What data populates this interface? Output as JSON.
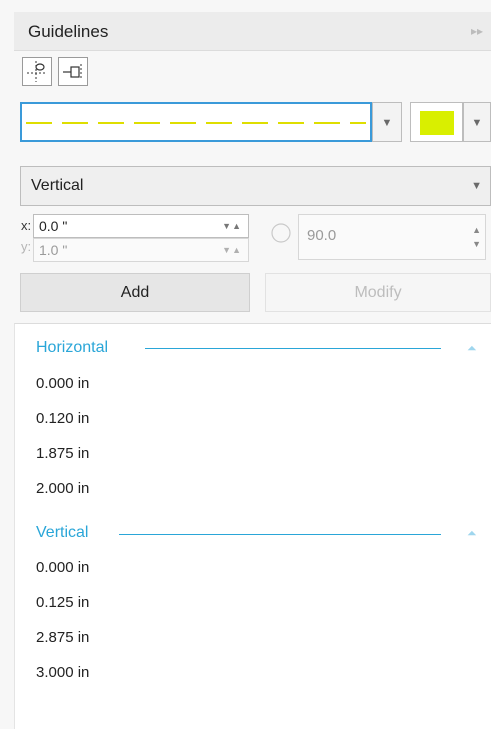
{
  "panel": {
    "title": "Guidelines",
    "collapse_icon": "double-chevron-right-icon"
  },
  "toolbar": {
    "tool1_icon": "guideline-point-icon",
    "tool2_icon": "guideline-object-icon"
  },
  "line_style": {
    "selected": "dashed",
    "color_name": "yellow",
    "color": "#dede00"
  },
  "color_picker": {
    "selected_color": "#d9ef00"
  },
  "orientation": {
    "selected": "Vertical"
  },
  "coords": {
    "x_label": "x:",
    "x_value": "0.0 \"",
    "y_label": "y:",
    "y_value": "1.0 \""
  },
  "angle": {
    "value": "90.0",
    "icon": "rotation-angle-icon"
  },
  "buttons": {
    "add": "Add",
    "modify": "Modify"
  },
  "guides": {
    "groups": [
      {
        "title": "Horizontal",
        "items": [
          "0.000 in",
          "0.120 in",
          "1.875 in",
          "2.000 in"
        ]
      },
      {
        "title": "Vertical",
        "items": [
          "0.000 in",
          "0.125 in",
          "2.875 in",
          "3.000 in"
        ]
      }
    ]
  },
  "colors": {
    "accent": "#2aa6d8",
    "selected_border": "#3a9ad9"
  }
}
